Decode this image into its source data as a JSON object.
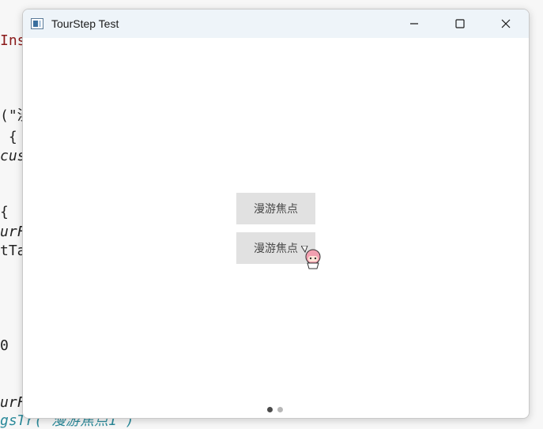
{
  "background_code": [
    {
      "text": "Ins",
      "style": "red"
    },
    {
      "text": "(\"漫",
      "style": ""
    },
    {
      "text": " {",
      "style": ""
    },
    {
      "text": "cus",
      "style": "italic"
    },
    {
      "text": "{",
      "style": ""
    },
    {
      "text": "urF",
      "style": "italic"
    },
    {
      "text": "tTa",
      "style": ""
    },
    {
      "text": "0",
      "style": ""
    },
    {
      "text": "urF",
      "style": "italic"
    },
    {
      "text": "gsTr(\"漫游焦点1\")",
      "style": "teal"
    }
  ],
  "window": {
    "title": "TourStep Test",
    "minimize_glyph": "—",
    "maximize_glyph": "☐",
    "close_glyph": "✕"
  },
  "buttons": [
    {
      "label": "漫游焦点"
    },
    {
      "label": "漫游焦点"
    }
  ],
  "pager": {
    "current": 1,
    "total": 2
  },
  "icons": {
    "app": "app-window-icon",
    "mascot": "anime-girl-cursor-icon"
  }
}
